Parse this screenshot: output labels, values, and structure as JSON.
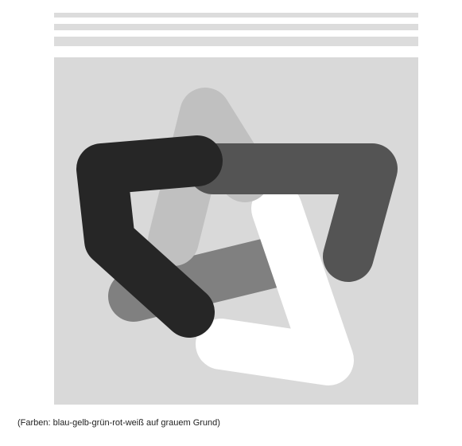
{
  "caption": "(Farben: blau-gelb-grün-rot-weiß auf grauem Grund)",
  "colors": {
    "background": "#ffffff",
    "stripes": "#dcdcdc",
    "panel": "#d9d9d9",
    "band_dark": "#262626",
    "band_light": "#c0c0c0",
    "band_mid_dark": "#545454",
    "band_white": "#ffffff",
    "band_mid": "#808080"
  },
  "emblem": {
    "band_count": 5,
    "band_color_names": [
      "blau",
      "gelb",
      "grün",
      "rot",
      "weiß"
    ]
  }
}
